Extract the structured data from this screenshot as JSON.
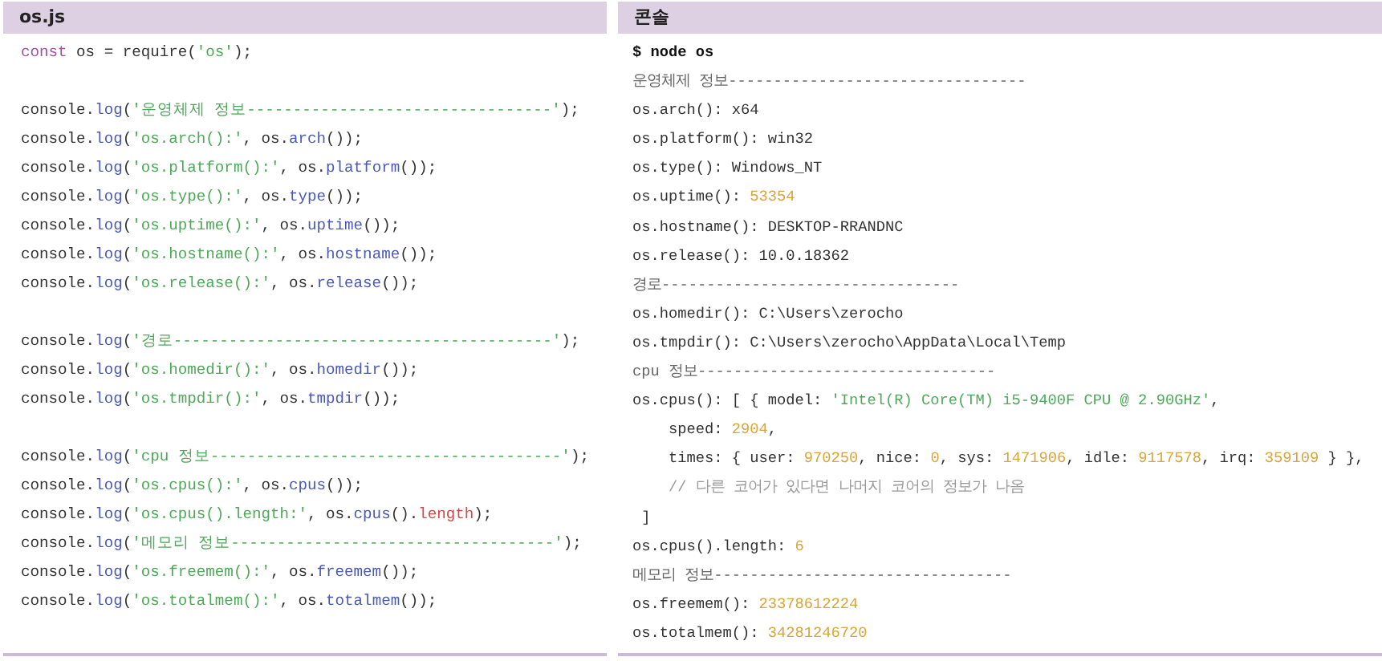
{
  "panels": [
    {
      "title": "os.js",
      "kind": "code",
      "blocks": [
        [
          {
            "tokens": [
              {
                "kind": "keyword",
                "text": "const"
              },
              {
                "kind": "plain",
                "text": " os = require("
              },
              {
                "kind": "string",
                "text": "'os'"
              },
              {
                "kind": "plain",
                "text": ");"
              }
            ]
          }
        ],
        [
          {
            "tokens": [
              {
                "kind": "plain",
                "text": "console."
              },
              {
                "kind": "method",
                "text": "log"
              },
              {
                "kind": "plain",
                "text": "("
              },
              {
                "kind": "string",
                "text": "'운영체제 정보---------------------------------'"
              },
              {
                "kind": "plain",
                "text": ");"
              }
            ]
          },
          {
            "tokens": [
              {
                "kind": "plain",
                "text": "console."
              },
              {
                "kind": "method",
                "text": "log"
              },
              {
                "kind": "plain",
                "text": "("
              },
              {
                "kind": "string",
                "text": "'os.arch():'"
              },
              {
                "kind": "plain",
                "text": ", os."
              },
              {
                "kind": "method",
                "text": "arch"
              },
              {
                "kind": "plain",
                "text": "());"
              }
            ]
          },
          {
            "tokens": [
              {
                "kind": "plain",
                "text": "console."
              },
              {
                "kind": "method",
                "text": "log"
              },
              {
                "kind": "plain",
                "text": "("
              },
              {
                "kind": "string",
                "text": "'os.platform():'"
              },
              {
                "kind": "plain",
                "text": ", os."
              },
              {
                "kind": "method",
                "text": "platform"
              },
              {
                "kind": "plain",
                "text": "());"
              }
            ]
          },
          {
            "tokens": [
              {
                "kind": "plain",
                "text": "console."
              },
              {
                "kind": "method",
                "text": "log"
              },
              {
                "kind": "plain",
                "text": "("
              },
              {
                "kind": "string",
                "text": "'os.type():'"
              },
              {
                "kind": "plain",
                "text": ", os."
              },
              {
                "kind": "method",
                "text": "type"
              },
              {
                "kind": "plain",
                "text": "());"
              }
            ]
          },
          {
            "tokens": [
              {
                "kind": "plain",
                "text": "console."
              },
              {
                "kind": "method",
                "text": "log"
              },
              {
                "kind": "plain",
                "text": "("
              },
              {
                "kind": "string",
                "text": "'os.uptime():'"
              },
              {
                "kind": "plain",
                "text": ", os."
              },
              {
                "kind": "method",
                "text": "uptime"
              },
              {
                "kind": "plain",
                "text": "());"
              }
            ]
          },
          {
            "tokens": [
              {
                "kind": "plain",
                "text": "console."
              },
              {
                "kind": "method",
                "text": "log"
              },
              {
                "kind": "plain",
                "text": "("
              },
              {
                "kind": "string",
                "text": "'os.hostname():'"
              },
              {
                "kind": "plain",
                "text": ", os."
              },
              {
                "kind": "method",
                "text": "hostname"
              },
              {
                "kind": "plain",
                "text": "());"
              }
            ]
          },
          {
            "tokens": [
              {
                "kind": "plain",
                "text": "console."
              },
              {
                "kind": "method",
                "text": "log"
              },
              {
                "kind": "plain",
                "text": "("
              },
              {
                "kind": "string",
                "text": "'os.release():'"
              },
              {
                "kind": "plain",
                "text": ", os."
              },
              {
                "kind": "method",
                "text": "release"
              },
              {
                "kind": "plain",
                "text": "());"
              }
            ]
          }
        ],
        [
          {
            "tokens": [
              {
                "kind": "plain",
                "text": "console."
              },
              {
                "kind": "method",
                "text": "log"
              },
              {
                "kind": "plain",
                "text": "("
              },
              {
                "kind": "string",
                "text": "'경로-----------------------------------------'"
              },
              {
                "kind": "plain",
                "text": ");"
              }
            ]
          },
          {
            "tokens": [
              {
                "kind": "plain",
                "text": "console."
              },
              {
                "kind": "method",
                "text": "log"
              },
              {
                "kind": "plain",
                "text": "("
              },
              {
                "kind": "string",
                "text": "'os.homedir():'"
              },
              {
                "kind": "plain",
                "text": ", os."
              },
              {
                "kind": "method",
                "text": "homedir"
              },
              {
                "kind": "plain",
                "text": "());"
              }
            ]
          },
          {
            "tokens": [
              {
                "kind": "plain",
                "text": "console."
              },
              {
                "kind": "method",
                "text": "log"
              },
              {
                "kind": "plain",
                "text": "("
              },
              {
                "kind": "string",
                "text": "'os.tmpdir():'"
              },
              {
                "kind": "plain",
                "text": ", os."
              },
              {
                "kind": "method",
                "text": "tmpdir"
              },
              {
                "kind": "plain",
                "text": "());"
              }
            ]
          }
        ],
        [
          {
            "tokens": [
              {
                "kind": "plain",
                "text": "console."
              },
              {
                "kind": "method",
                "text": "log"
              },
              {
                "kind": "plain",
                "text": "("
              },
              {
                "kind": "string",
                "text": "'cpu 정보--------------------------------------'"
              },
              {
                "kind": "plain",
                "text": ");"
              }
            ]
          },
          {
            "tokens": [
              {
                "kind": "plain",
                "text": "console."
              },
              {
                "kind": "method",
                "text": "log"
              },
              {
                "kind": "plain",
                "text": "("
              },
              {
                "kind": "string",
                "text": "'os.cpus():'"
              },
              {
                "kind": "plain",
                "text": ", os."
              },
              {
                "kind": "method",
                "text": "cpus"
              },
              {
                "kind": "plain",
                "text": "());"
              }
            ]
          },
          {
            "tokens": [
              {
                "kind": "plain",
                "text": "console."
              },
              {
                "kind": "method",
                "text": "log"
              },
              {
                "kind": "plain",
                "text": "("
              },
              {
                "kind": "string",
                "text": "'os.cpus().length:'"
              },
              {
                "kind": "plain",
                "text": ", os."
              },
              {
                "kind": "method",
                "text": "cpus"
              },
              {
                "kind": "plain",
                "text": "()."
              },
              {
                "kind": "property",
                "text": "length"
              },
              {
                "kind": "plain",
                "text": ");"
              }
            ]
          },
          {
            "tokens": [
              {
                "kind": "plain",
                "text": "console."
              },
              {
                "kind": "method",
                "text": "log"
              },
              {
                "kind": "plain",
                "text": "("
              },
              {
                "kind": "string",
                "text": "'메모리 정보-----------------------------------'"
              },
              {
                "kind": "plain",
                "text": ");"
              }
            ]
          },
          {
            "tokens": [
              {
                "kind": "plain",
                "text": "console."
              },
              {
                "kind": "method",
                "text": "log"
              },
              {
                "kind": "plain",
                "text": "("
              },
              {
                "kind": "string",
                "text": "'os.freemem():'"
              },
              {
                "kind": "plain",
                "text": ", os."
              },
              {
                "kind": "method",
                "text": "freemem"
              },
              {
                "kind": "plain",
                "text": "());"
              }
            ]
          },
          {
            "tokens": [
              {
                "kind": "plain",
                "text": "console."
              },
              {
                "kind": "method",
                "text": "log"
              },
              {
                "kind": "plain",
                "text": "("
              },
              {
                "kind": "string",
                "text": "'os.totalmem():'"
              },
              {
                "kind": "plain",
                "text": ", os."
              },
              {
                "kind": "method",
                "text": "totalmem"
              },
              {
                "kind": "plain",
                "text": "());"
              }
            ]
          }
        ]
      ]
    },
    {
      "title": "콘솔",
      "kind": "console",
      "blocks": [
        [
          {
            "tokens": [
              {
                "kind": "prompt",
                "text": "$ node os"
              }
            ]
          },
          {
            "tokens": [
              {
                "kind": "muted",
                "text": "운영체제 정보---------------------------------"
              }
            ]
          },
          {
            "tokens": [
              {
                "kind": "plain",
                "text": "os.arch(): x64"
              }
            ]
          },
          {
            "tokens": [
              {
                "kind": "plain",
                "text": "os.platform(): win32"
              }
            ]
          },
          {
            "tokens": [
              {
                "kind": "plain",
                "text": "os.type(): Windows_NT"
              }
            ]
          },
          {
            "tokens": [
              {
                "kind": "plain",
                "text": "os.uptime(): "
              },
              {
                "kind": "number",
                "text": "53354"
              }
            ]
          },
          {
            "tokens": [
              {
                "kind": "plain",
                "text": "os.hostname(): DESKTOP-RRANDNC"
              }
            ]
          },
          {
            "tokens": [
              {
                "kind": "plain",
                "text": "os.release(): 10.0.18362"
              }
            ]
          },
          {
            "tokens": [
              {
                "kind": "muted",
                "text": "경로---------------------------------"
              }
            ]
          },
          {
            "tokens": [
              {
                "kind": "plain",
                "text": "os.homedir(): C:\\Users\\zerocho"
              }
            ]
          },
          {
            "tokens": [
              {
                "kind": "plain",
                "text": "os.tmpdir(): C:\\Users\\zerocho\\AppData\\Local\\Temp"
              }
            ]
          },
          {
            "tokens": [
              {
                "kind": "muted",
                "text": "cpu 정보---------------------------------"
              }
            ]
          },
          {
            "tokens": [
              {
                "kind": "plain",
                "text": "os.cpus(): [ { model: "
              },
              {
                "kind": "string",
                "text": "'Intel(R) Core(TM) i5-9400F CPU @ 2.90GHz'"
              },
              {
                "kind": "plain",
                "text": ","
              }
            ]
          },
          {
            "tokens": [
              {
                "kind": "plain",
                "text": "    speed: "
              },
              {
                "kind": "number",
                "text": "2904"
              },
              {
                "kind": "plain",
                "text": ","
              }
            ]
          },
          {
            "tokens": [
              {
                "kind": "plain",
                "text": "    times: { user: "
              },
              {
                "kind": "number",
                "text": "970250"
              },
              {
                "kind": "plain",
                "text": ", nice: "
              },
              {
                "kind": "number",
                "text": "0"
              },
              {
                "kind": "plain",
                "text": ", sys: "
              },
              {
                "kind": "number",
                "text": "1471906"
              },
              {
                "kind": "plain",
                "text": ", idle: "
              },
              {
                "kind": "number",
                "text": "9117578"
              },
              {
                "kind": "plain",
                "text": ", irq: "
              },
              {
                "kind": "number",
                "text": "359109"
              },
              {
                "kind": "plain",
                "text": " } },"
              }
            ]
          },
          {
            "tokens": [
              {
                "kind": "comment",
                "text": "    // 다른 코어가 있다면 나머지 코어의 정보가 나옴"
              }
            ]
          },
          {
            "tokens": [
              {
                "kind": "plain",
                "text": " ]"
              }
            ]
          },
          {
            "tokens": [
              {
                "kind": "plain",
                "text": "os.cpus().length: "
              },
              {
                "kind": "number",
                "text": "6"
              }
            ]
          },
          {
            "tokens": [
              {
                "kind": "muted",
                "text": "메모리 정보---------------------------------"
              }
            ]
          },
          {
            "tokens": [
              {
                "kind": "plain",
                "text": "os.freemem(): "
              },
              {
                "kind": "number",
                "text": "23378612224"
              }
            ]
          },
          {
            "tokens": [
              {
                "kind": "plain",
                "text": "os.totalmem(): "
              },
              {
                "kind": "number",
                "text": "34281246720"
              }
            ]
          }
        ]
      ]
    }
  ]
}
